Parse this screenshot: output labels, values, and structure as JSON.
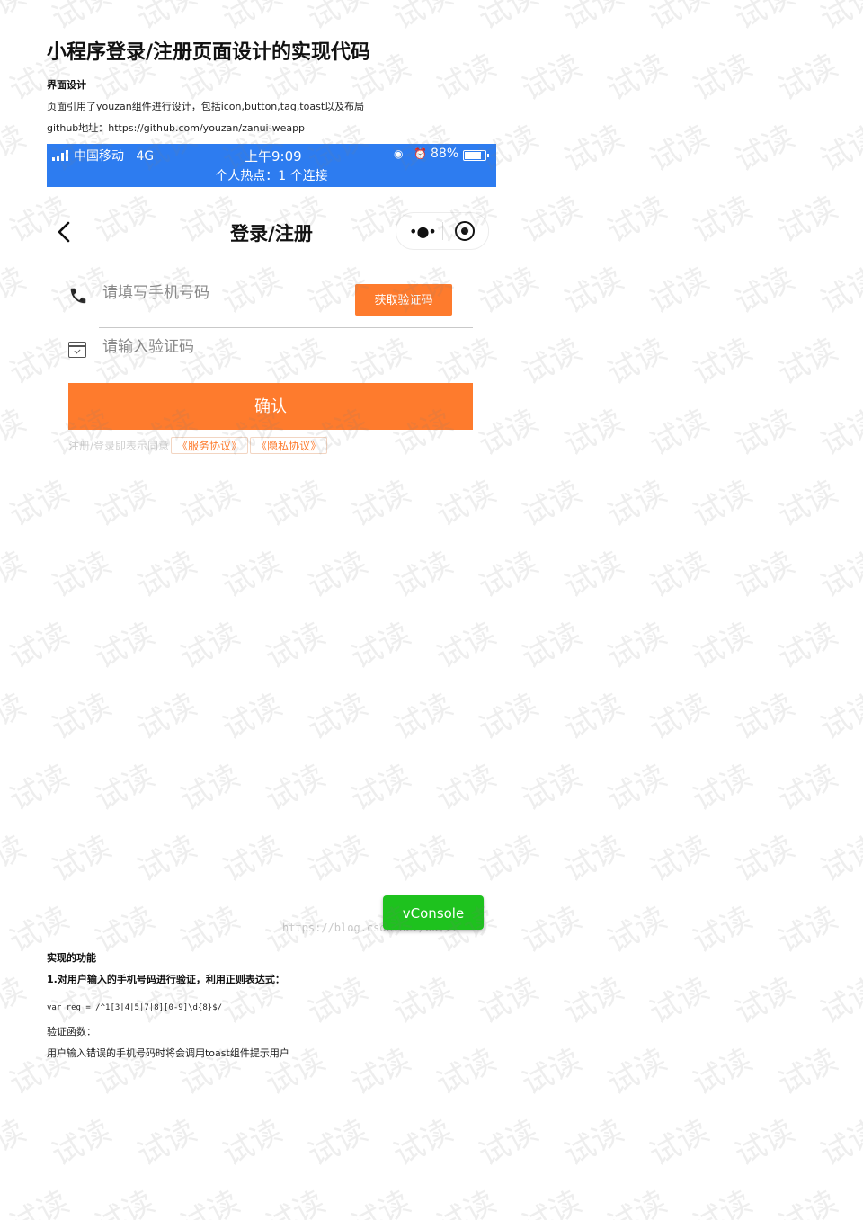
{
  "document": {
    "title": "小程序登录/注册页面设计的实现代码",
    "section_design": "界面设计",
    "design_desc": "页面引用了youzan组件进行设计，包括icon,button,tag,toast以及布局",
    "github": "github地址：https://github.com/youzan/zanui-weapp",
    "section_features": "实现的功能",
    "feature_1": "1.对用户输入的手机号码进行验证，利用正则表达式：",
    "regex_line": "var reg = /^1[3|4|5|7|8][0-9]\\d{8}$/",
    "verify_func": "验证函数：",
    "toast_desc": "用户输入错误的手机号码时将会调用toast组件提示用户",
    "blog_url": "https://blog.csdn.net/bu...",
    "watermark": "试读"
  },
  "status_bar": {
    "carrier": "中国移动",
    "network": "4G",
    "time": "上午9:09",
    "battery": "88%",
    "battery_level": 0.88,
    "hotspot": "个人热点：1 个连接"
  },
  "nav": {
    "title": "登录/注册",
    "more_icon": "ellipsis-icon",
    "capsule_icon": "target-icon"
  },
  "form": {
    "phone_placeholder": "请填写手机号码",
    "code_button": "获取验证码",
    "code_placeholder": "请输入验证码",
    "confirm_button": "确认",
    "agree_text": "注册/登录即表示同意",
    "service_tag": "《服务协议》",
    "privacy_tag": "《隐私协议》"
  },
  "vconsole": {
    "label": "vConsole"
  },
  "colors": {
    "status_bar": "#2d7cf0",
    "accent": "#fe7b2d",
    "vconsole": "#1ec21e"
  }
}
